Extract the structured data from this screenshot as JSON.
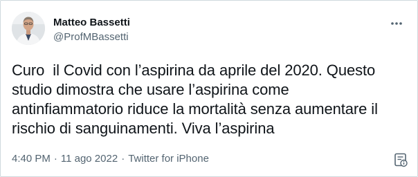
{
  "tweet": {
    "author": {
      "display_name": "Matteo Bassetti",
      "handle": "@ProfMBassetti",
      "avatar_icon": "profile-photo"
    },
    "text": "Curo  il Covid con l’aspirina da aprile del 2020. Questo\nstudio dimostra che usare l’aspirina come\nantinfiammatorio riduce la mortalità senza aumentare il\nrischio di sanguinamenti. Viva l’aspirina",
    "time": "4:40 PM",
    "separator_1": "·",
    "date": "11 ago 2022",
    "separator_2": "·",
    "source": "Twitter for iPhone",
    "more_icon": "more-horizontal-icon",
    "info_icon": "tweet-info-icon"
  },
  "colors": {
    "text_primary": "#0f1419",
    "text_secondary": "#536471",
    "border": "#cfd9de"
  }
}
